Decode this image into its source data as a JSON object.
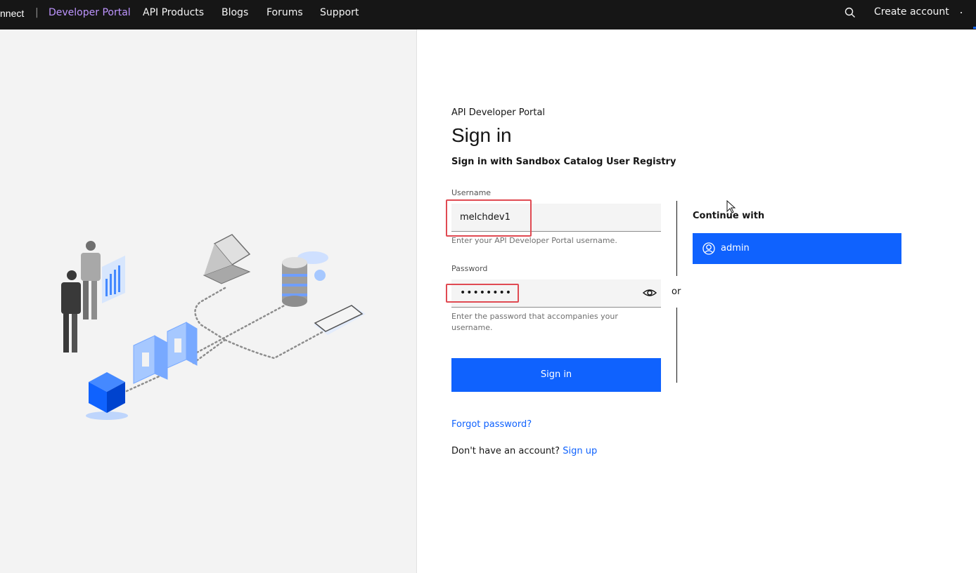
{
  "nav": {
    "brand_fragment": "nnect",
    "separator": "|",
    "portal_label": "Developer Portal",
    "items": [
      "API Products",
      "Blogs",
      "Forums",
      "Support"
    ],
    "create_account": "Create account",
    "accent_color": "#be95ff"
  },
  "form": {
    "eyebrow": "API Developer Portal",
    "title": "Sign in",
    "subtitle": "Sign in with Sandbox Catalog User Registry",
    "username_label": "Username",
    "username_value": "melchdev1",
    "username_helper": "Enter your API Developer Portal username.",
    "password_label": "Password",
    "password_masked": "••••••••",
    "password_helper": "Enter the password that accompanies your username.",
    "signin_label": "Sign in",
    "forgot_label": "Forgot password?",
    "no_account_text": "Don't have an account?",
    "signup_label": "Sign up"
  },
  "divider": {
    "or_label": "or"
  },
  "sso": {
    "heading": "Continue with",
    "provider_label": "admin",
    "provider_icon": "user-avatar-icon"
  },
  "colors": {
    "primary": "#0f62fe",
    "nav_bg": "#161616",
    "highlight_box": "#e04a52"
  }
}
